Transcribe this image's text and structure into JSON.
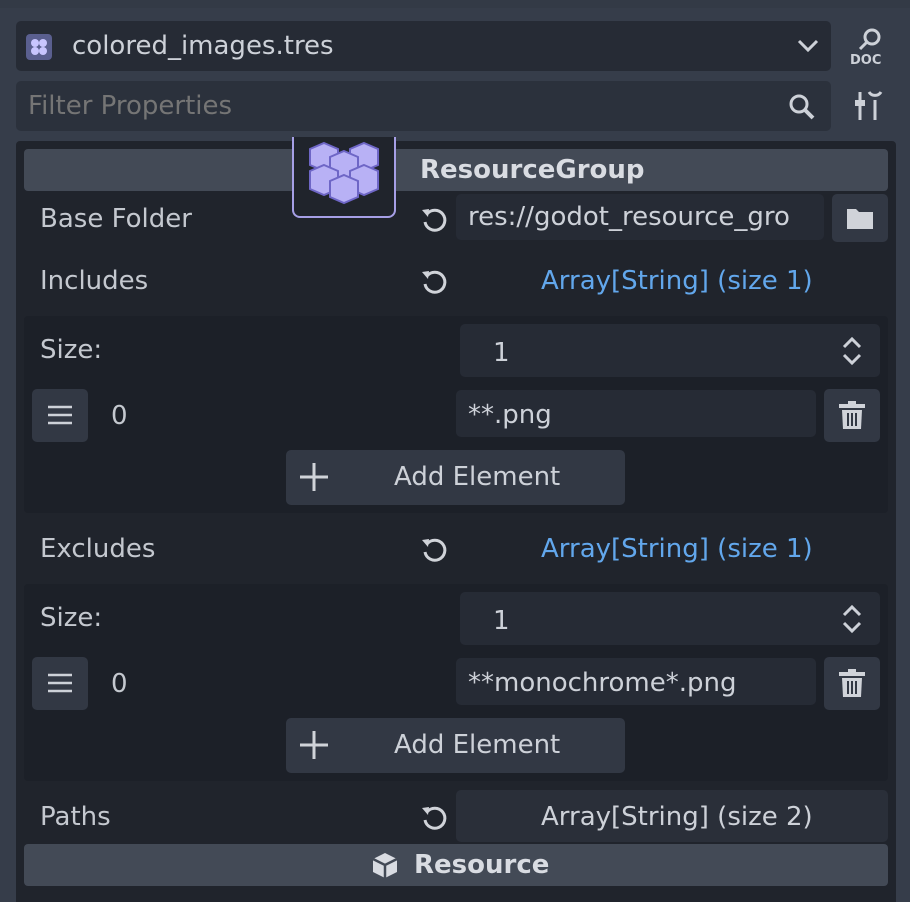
{
  "resource_picker": {
    "file_name": "colored_images.tres"
  },
  "filter": {
    "placeholder": "Filter Properties"
  },
  "icons": {
    "doc": "doc-icon",
    "tools": "tools-icon",
    "search": "search-icon",
    "reset": "reset-icon",
    "folder": "folder-icon",
    "drag": "drag-handle-icon",
    "trash": "trash-icon",
    "plus": "plus-icon",
    "cube": "cube-icon",
    "resource_group": "resource-group-icon"
  },
  "colors": {
    "accent_link": "#62a7ec",
    "panel": "#20242c",
    "background": "#363d4a"
  },
  "inspector": {
    "section_title": "ResourceGroup",
    "base_folder": {
      "label": "Base Folder",
      "value": "res://godot_resource_gro"
    },
    "includes": {
      "label": "Includes",
      "array_label": "Array[String] (size 1)",
      "size_label": "Size:",
      "size_value": "1",
      "items": [
        {
          "index": "0",
          "value": "**.png"
        }
      ],
      "add_label": "Add Element"
    },
    "excludes": {
      "label": "Excludes",
      "array_label": "Array[String] (size 1)",
      "size_label": "Size:",
      "size_value": "1",
      "items": [
        {
          "index": "0",
          "value": "**monochrome*.png"
        }
      ],
      "add_label": "Add Element"
    },
    "paths": {
      "label": "Paths",
      "array_label": "Array[String] (size 2)"
    },
    "resource_section": {
      "title": "Resource"
    }
  }
}
